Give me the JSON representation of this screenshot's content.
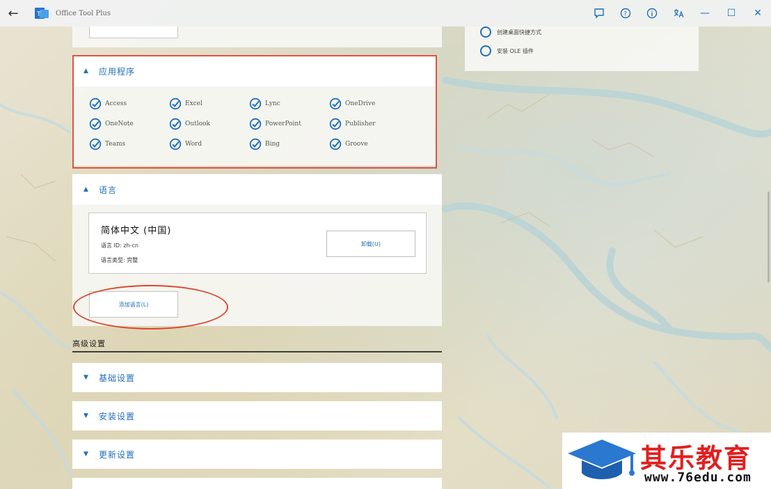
{
  "titlebar": {
    "app_title": "Office Tool Plus",
    "icons": [
      "back-icon",
      "feedback-icon",
      "help-icon",
      "info-icon",
      "language-icon"
    ],
    "window": {
      "minimize": "—",
      "maximize": "☐",
      "close": "✕"
    }
  },
  "right_panel": {
    "options": [
      {
        "label": "创建桌面快捷方式",
        "icon": "radio-icon"
      },
      {
        "label": "安装 OLE 插件",
        "icon": "radio-icon"
      }
    ]
  },
  "apps_section": {
    "title": "应用程序",
    "items": [
      "Access",
      "Excel",
      "Lync",
      "OneDrive",
      "OneNote",
      "Outlook",
      "PowerPoint",
      "Publisher",
      "Teams",
      "Word",
      "Bing",
      "Groove"
    ]
  },
  "language_section": {
    "title": "语言",
    "card": {
      "name": "简体中文 (中国)",
      "id_line": "语言 ID: zh-cn",
      "type_line": "语言类型: 完整",
      "uninstall": "卸载(U)"
    },
    "add_button": "添加语言(L)"
  },
  "advanced": {
    "title": "高级设置",
    "sections": [
      "基础设置",
      "安装设置",
      "更新设置"
    ]
  },
  "watermark": {
    "name": "其乐教育",
    "url": "www.76edu.com"
  },
  "colors": {
    "accent": "#1f6fb8",
    "highlight": "#e05243"
  }
}
